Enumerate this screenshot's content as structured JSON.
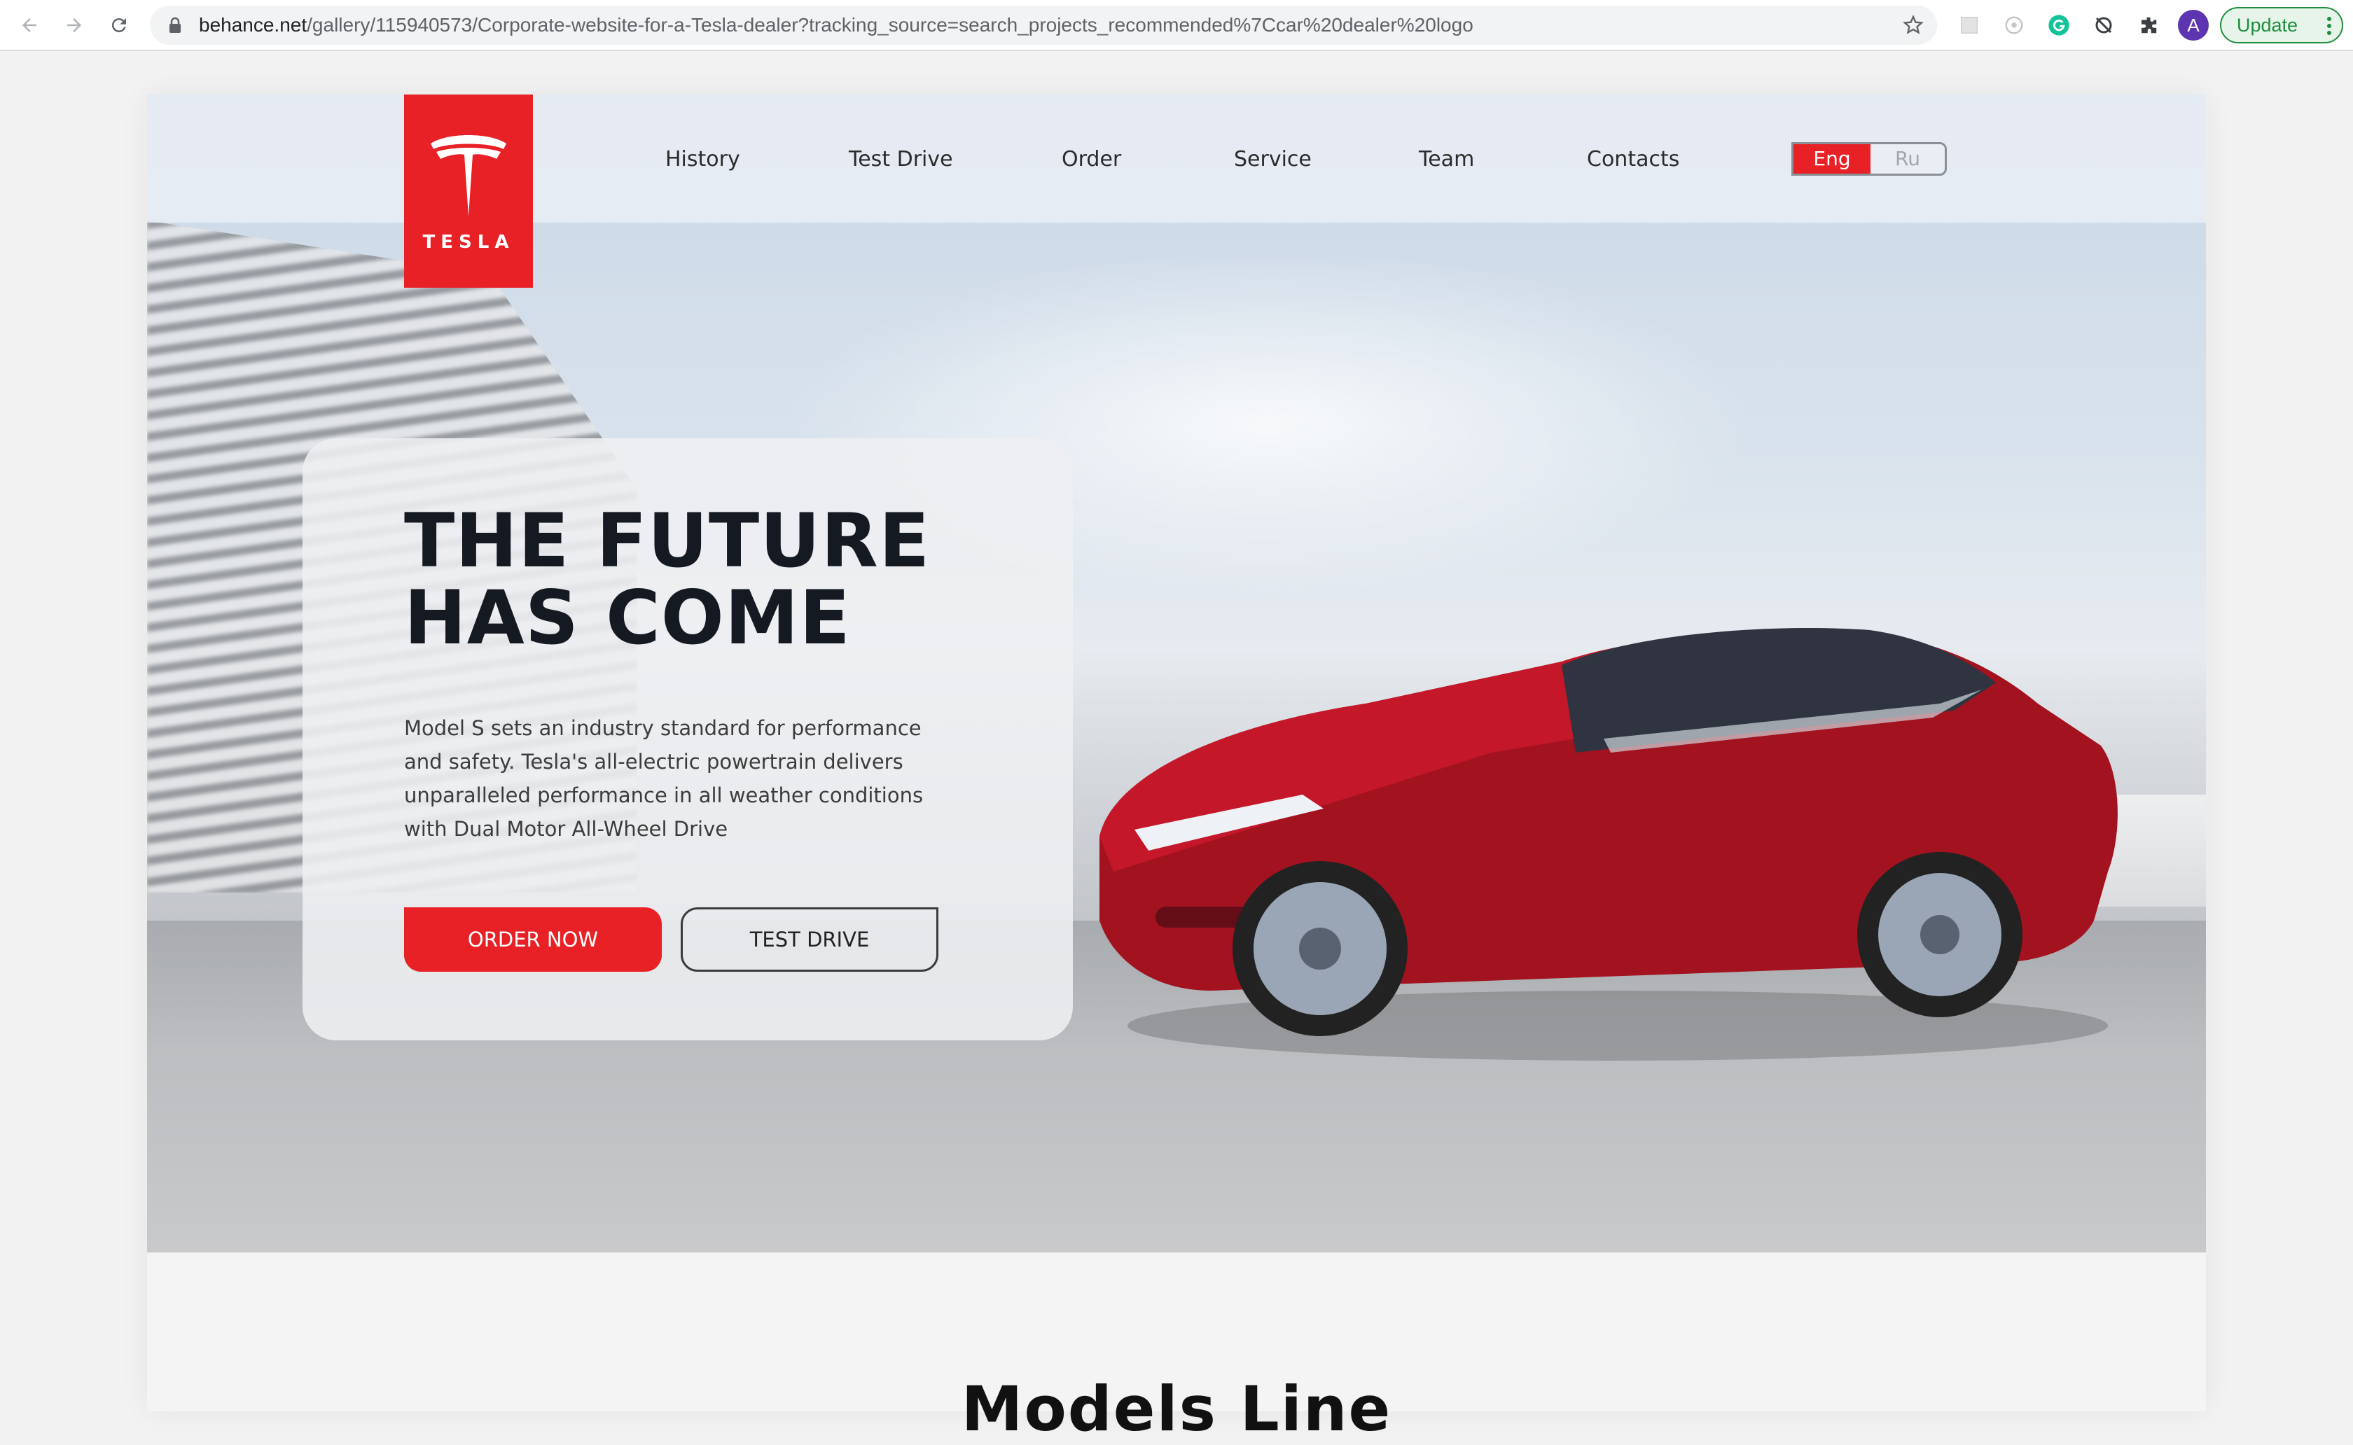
{
  "browser": {
    "url_domain": "behance.net",
    "url_path": "/gallery/115940573/Corporate-website-for-a-Tesla-dealer?tracking_source=search_projects_recommended%7Ccar%20dealer%20logo",
    "avatar_letter": "A",
    "update_label": "Update",
    "icons": [
      "back-icon",
      "forward-icon",
      "reload-icon",
      "lock-icon",
      "star-icon",
      "extension-icon",
      "grammarly-icon",
      "sync-icon",
      "puzzle-icon",
      "more-icon"
    ]
  },
  "header": {
    "logo_text": "TESLA",
    "nav": [
      "History",
      "Test Drive",
      "Order",
      "Service",
      "Team",
      "Contacts"
    ],
    "lang_active": "Eng",
    "lang_inactive": "Ru"
  },
  "hero": {
    "title": "THE FUTURE\nHAS COME",
    "text": "Model S sets an industry standard for performance and safety. Tesla's all-electric powertrain delivers unparalleled performance in all weather conditions with Dual Motor All-Wheel Drive",
    "order_label": "ORDER NOW",
    "test_label": "TEST DRIVE"
  },
  "models": {
    "heading": "Models Line"
  },
  "colors": {
    "brand_red": "#e82127",
    "text_dark": "#151a22"
  }
}
